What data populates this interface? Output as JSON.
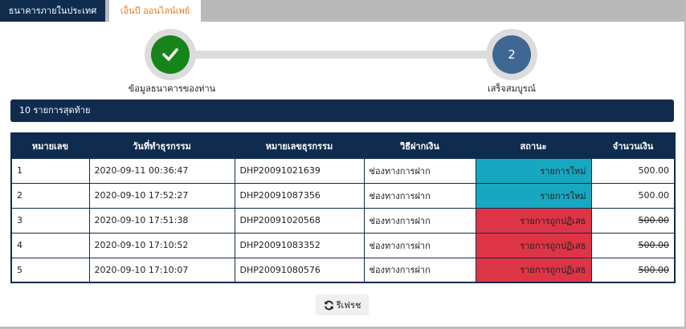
{
  "tabs": [
    {
      "label": "ธนาคารภายในประเทศ"
    },
    {
      "label": "เอ็นบี ออนไลน์เพย์"
    }
  ],
  "stepper": {
    "steps": [
      {
        "label": "ข้อมูลธนาคารของท่าน",
        "icon": "check-icon",
        "state": "done"
      },
      {
        "label": "เสร็จสมบูรณ์",
        "number": "2",
        "state": "current"
      }
    ]
  },
  "recent": {
    "title": "10 รายการสุดท้าย"
  },
  "table": {
    "headers": [
      "หมายเลข",
      "วันที่ทำธุรกรรม",
      "หมายเลขธุรกรรม",
      "วิธีฝากเงิน",
      "สถานะ",
      "จำนวนเงิน"
    ],
    "rows": [
      {
        "no": "1",
        "date": "2020-09-11 00:36:47",
        "txid": "DHP20091021639",
        "method": "ช่องทางการฝาก",
        "status": "รายการใหม่",
        "amount": "500.00"
      },
      {
        "no": "2",
        "date": "2020-09-10 17:52:27",
        "txid": "DHP20091087356",
        "method": "ช่องทางการฝาก",
        "status": "รายการใหม่",
        "amount": "500.00"
      },
      {
        "no": "3",
        "date": "2020-09-10 17:51:38",
        "txid": "DHP20091020568",
        "method": "ช่องทางการฝาก",
        "status": "รายการถูกปฏิเสธ",
        "amount": "500.00"
      },
      {
        "no": "4",
        "date": "2020-09-10 17:10:52",
        "txid": "DHP20091083352",
        "method": "ช่องทางการฝาก",
        "status": "รายการถูกปฏิเสธ",
        "amount": "500.00"
      },
      {
        "no": "5",
        "date": "2020-09-10 17:10:07",
        "txid": "DHP20091080576",
        "method": "ช่องทางการฝาก",
        "status": "รายการถูกปฏิเสธ",
        "amount": "500.00"
      }
    ]
  },
  "refresh": {
    "label": "รีเฟรช",
    "icon": "refresh-icon"
  },
  "colors": {
    "navy": "#0f2c4e",
    "accent_orange": "#ea7b1c",
    "status_new": "#18a7c0",
    "status_rejected": "#de3546",
    "step_done": "#17841b",
    "step_current": "#3e6794"
  }
}
